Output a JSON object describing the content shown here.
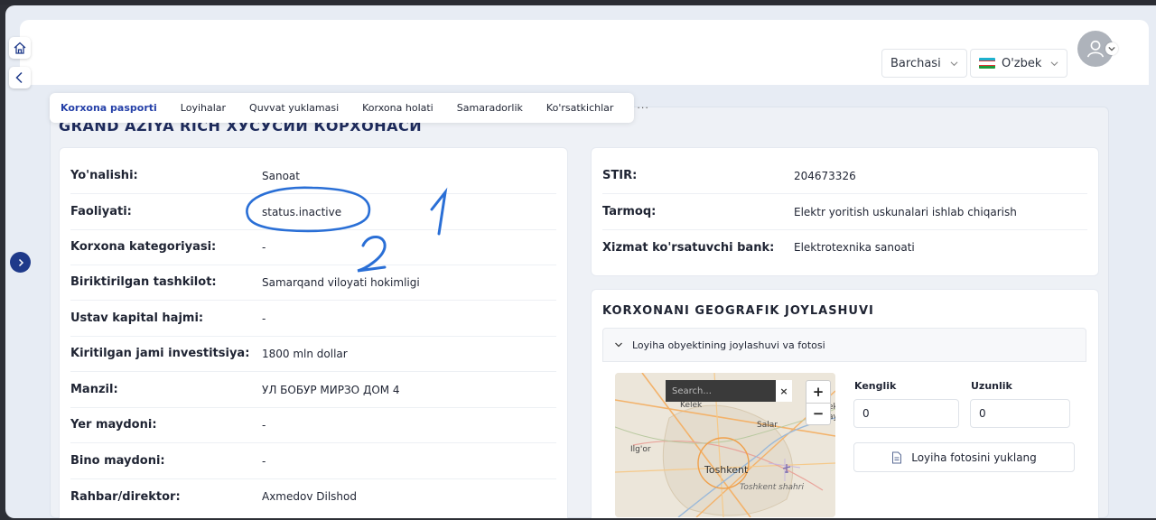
{
  "header": {
    "filter_dropdown": "Barchasi",
    "language_dropdown": "O'zbek"
  },
  "tabs": [
    {
      "label": "Korxona pasporti"
    },
    {
      "label": "Loyihalar"
    },
    {
      "label": "Quvvat yuklamasi"
    },
    {
      "label": "Korxona holati"
    },
    {
      "label": "Samaradorlik"
    },
    {
      "label": "Ko'rsatkichlar"
    },
    {
      "label": "···"
    }
  ],
  "enterprise": {
    "name": "GRAND AZIYA RICH ХУСУСИЙ КОРХОНАСИ"
  },
  "left_info": [
    {
      "label": "Yo'nalishi:",
      "value": "Sanoat"
    },
    {
      "label": "Faoliyati:",
      "value": "status.inactive"
    },
    {
      "label": "Korxona kategoriyasi:",
      "value": "-"
    },
    {
      "label": "Biriktirilgan tashkilot:",
      "value": "Samarqand viloyati hokimligi"
    },
    {
      "label": "Ustav kapital hajmi:",
      "value": "-"
    },
    {
      "label": "Kiritilgan jami investitsiya:",
      "value": "1800 mln dollar"
    },
    {
      "label": "Manzil:",
      "value": "УЛ БОБУР МИРЗО ДОМ 4"
    },
    {
      "label": "Yer maydoni:",
      "value": "-"
    },
    {
      "label": "Bino maydoni:",
      "value": "-"
    },
    {
      "label": "Rahbar/direktor:",
      "value": "Axmedov Dilshod"
    }
  ],
  "right_info": [
    {
      "label": "STIR:",
      "value": "204673326"
    },
    {
      "label": "Tarmoq:",
      "value": "Elektr yoritish uskunalari ishlab chiqarish"
    },
    {
      "label": "Xizmat ko'rsatuvchi bank:",
      "value": "Elektrotexnika sanoati"
    }
  ],
  "geo": {
    "title": "KORXONANI GEOGRAFIK JOYLASHUVI",
    "accordion_label": "Loyiha obyektining joylashuvi va fotosi",
    "map_search_placeholder": "Search...",
    "map_close": "×",
    "zoom_in": "+",
    "zoom_out": "−",
    "map_labels": [
      "Kelek",
      "Salar",
      "Ilg'or",
      "Toshkent",
      "Toshkent shahri",
      "ek",
      "ay"
    ],
    "latitude_label": "Kenglik",
    "latitude_value": "0",
    "longitude_label": "Uzunlik",
    "longitude_value": "0",
    "upload_button": "Loyiha fotosini yuklang"
  },
  "annotations": [
    "1",
    "2"
  ],
  "colors": {
    "accent": "#2540a8",
    "annotation_ink": "#2a6fd6",
    "expand_button": "#1f3a8a"
  }
}
